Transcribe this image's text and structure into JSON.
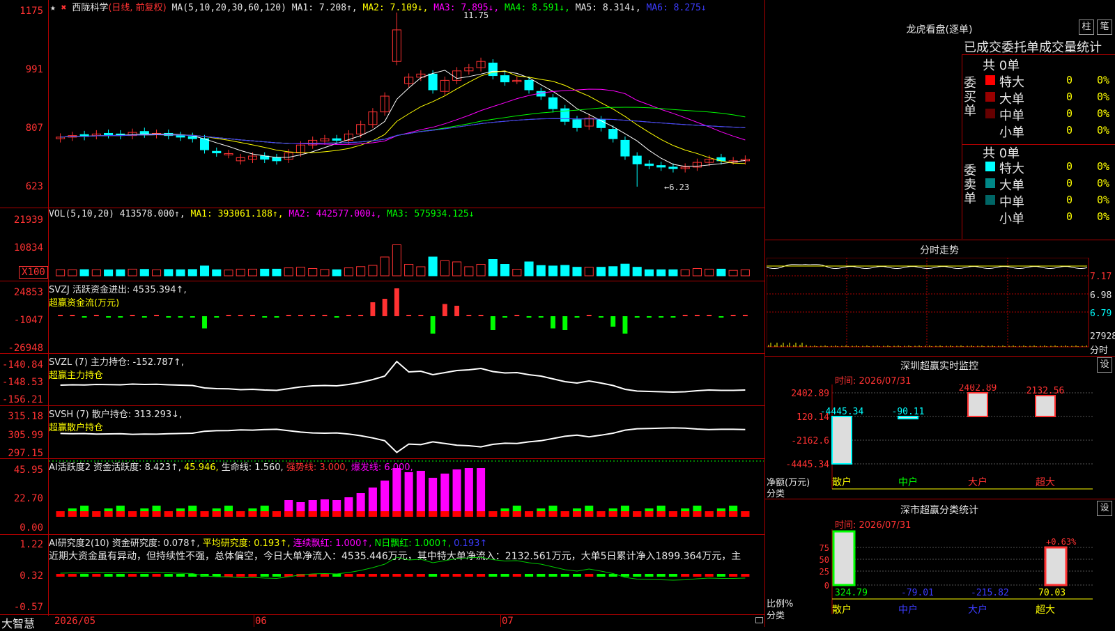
{
  "app": {
    "brand": "大智慧"
  },
  "main_chart": {
    "star": "★",
    "name": "西陇科学",
    "mode": "(日线, 前复权)",
    "ma_spec": "MA(5,10,20,30,60,120)",
    "ma1": "MA1: 7.208↑,",
    "ma2": "MA2: 7.109↓,",
    "ma3": "MA3: 7.895↓,",
    "ma4": "MA4: 8.591↓,",
    "ma5": "MA5: 8.314↓,",
    "ma6": "MA6: 8.275↓",
    "y_ticks": [
      "1175",
      "991",
      "807",
      "623"
    ],
    "high_label": "11.75",
    "low_label": "←6.23"
  },
  "vol_panel": {
    "title": "VOL(5,10,20)",
    "value": "413578.000↑,",
    "ma1": "MA1: 393061.188↑,",
    "ma2": "MA2: 442577.000↓,",
    "ma3": "MA3: 575934.125↓",
    "y_ticks": [
      "21939",
      "10834",
      "X100"
    ]
  },
  "svzj_panel": {
    "title": "SVZJ  活跃资金进出: 4535.394↑,",
    "subtitle": "超赢资金流(万元)",
    "y_ticks": [
      "24853",
      "-1047",
      "-26948"
    ]
  },
  "svzl_panel": {
    "title": "SVZL (7) 主力持仓: -152.787↑,",
    "subtitle": "超赢主力持仓",
    "y_ticks": [
      "-140.84",
      "-148.53",
      "-156.21"
    ]
  },
  "svsh_panel": {
    "title": "SVSH (7) 散户持仓: 313.293↓,",
    "subtitle": "超赢散户持仓",
    "y_ticks": [
      "315.18",
      "305.99",
      "297.15"
    ]
  },
  "ai_active": {
    "title": "AI活跃度2 资金活跃度: 8.423↑,",
    "v2": "45.946,",
    "life": "生命线: 1.560,",
    "strong": "强势线: 3.000,",
    "burst": "爆发线: 6.000,",
    "y_ticks": [
      "45.95",
      "22.70",
      "0.00"
    ]
  },
  "ai_research": {
    "title": "AI研究度2(10) 资金研究度: 0.078↑,",
    "avg": "平均研究度: 0.193↑,",
    "cont": "连续飘红: 1.000↑,",
    "nday": "N日飘红: 1.000↑,",
    "last": "0.193↑",
    "comment": "近期大资金虽有异动，但持续性不强，总体偏空，今日大单净流入：4535.446万元，其中特大单净流入：2132.561万元，大单5日累计净入1899.364万元，主",
    "y_ticks": [
      "1.22",
      "0.32",
      "-0.57"
    ]
  },
  "x_axis": {
    "labels": [
      "2026/05",
      "06",
      "07"
    ]
  },
  "right_panel": {
    "dragon_title": "龙虎看盘(逐单)",
    "btn_zhu": "柱",
    "btn_bi": "笔",
    "tabs": "已成交委托单成交量统计",
    "buy_label": "委买单",
    "sell_label": "委卖单",
    "buy_total": "共 0单",
    "sell_total": "共 0单",
    "buy_rows": [
      {
        "name": "特大",
        "count": "0",
        "pct": "0%",
        "color": "#ff0000"
      },
      {
        "name": "大单",
        "count": "0",
        "pct": "0%",
        "color": "#990000"
      },
      {
        "name": "中单",
        "count": "0",
        "pct": "0%",
        "color": "#660000"
      },
      {
        "name": "小单",
        "count": "0",
        "pct": "0%",
        "color": "#000000"
      }
    ],
    "sell_rows": [
      {
        "name": "特大",
        "count": "0",
        "pct": "0%",
        "color": "#00ffff"
      },
      {
        "name": "大单",
        "count": "0",
        "pct": "0%",
        "color": "#008888"
      },
      {
        "name": "中单",
        "count": "0",
        "pct": "0%",
        "color": "#006666"
      },
      {
        "name": "小单",
        "count": "0",
        "pct": "0%",
        "color": "#000000"
      }
    ],
    "intraday_title": "分时走势",
    "intraday_ticks": [
      "7.17",
      "6.98",
      "6.79",
      "27928",
      "分时"
    ],
    "sz_monitor_title": "深圳超赢实时监控",
    "sz_btn": "设",
    "sz_time": "时间: 2026/07/31",
    "sz_ticks": [
      "2402.89",
      "120.14",
      "-2162.6",
      "-4445.34"
    ],
    "sz_values": [
      "-4445.34",
      "-90.11",
      "2402.89",
      "2132.56"
    ],
    "sz_ylabel": "净额(万元)",
    "sz_xlabel": "分类",
    "categories": [
      "散户",
      "中户",
      "大户",
      "超大"
    ],
    "sm_title": "深市超赢分类统计",
    "sm_btn": "设",
    "sm_time": "时间: 2026/07/31",
    "sm_ticks": [
      "75",
      "50",
      "25",
      "0"
    ],
    "sm_pct_label": "+0.63%",
    "sm_values": [
      "324.79",
      "-79.01",
      "-215.82",
      "70.03"
    ],
    "sm_ylabel": "比例%",
    "sm_xlabel": "分类"
  },
  "chart_data": {
    "type": "bar",
    "title": "深圳超赢实时监控",
    "categories": [
      "散户",
      "中户",
      "大户",
      "超大"
    ],
    "series": [
      {
        "values": [
          -4445.34,
          -90.11,
          2402.89,
          2132.56
        ]
      }
    ],
    "ylabel": "净额(万元)",
    "ylim": [
      -4445.34,
      2402.89
    ],
    "candles": {
      "ylim": [
        6.23,
        11.75
      ],
      "close": [
        7.8,
        7.85,
        7.82,
        7.9,
        7.88,
        7.85,
        7.95,
        7.9,
        7.92,
        7.85,
        7.8,
        7.75,
        7.4,
        7.3,
        7.28,
        7.15,
        7.2,
        7.1,
        7.05,
        7.3,
        7.55,
        7.7,
        7.75,
        7.7,
        7.9,
        8.2,
        8.6,
        9.1,
        11.2,
        9.7,
        9.8,
        9.3,
        9.6,
        9.9,
        10.0,
        10.2,
        9.75,
        9.55,
        9.6,
        9.3,
        9.1,
        8.7,
        8.3,
        8.1,
        8.4,
        8.1,
        7.75,
        7.2,
        6.95,
        6.9,
        6.85,
        6.8,
        6.85,
        7.0,
        7.1,
        7.05,
        7.05,
        7.1
      ],
      "open": [
        7.75,
        7.8,
        7.88,
        7.85,
        7.92,
        7.9,
        7.85,
        7.98,
        7.88,
        7.92,
        7.85,
        7.82,
        7.75,
        7.35,
        7.25,
        7.05,
        7.1,
        7.2,
        7.15,
        7.1,
        7.3,
        7.55,
        7.68,
        7.75,
        7.7,
        7.9,
        8.2,
        8.6,
        10.2,
        9.5,
        9.7,
        9.8,
        9.25,
        9.6,
        9.9,
        10.0,
        10.15,
        9.75,
        9.6,
        9.6,
        9.25,
        9.05,
        8.7,
        8.35,
        8.15,
        8.35,
        8.05,
        7.7,
        7.2,
        6.95,
        6.9,
        6.85,
        6.8,
        6.85,
        7.0,
        7.15,
        7.05,
        7.05
      ]
    }
  }
}
